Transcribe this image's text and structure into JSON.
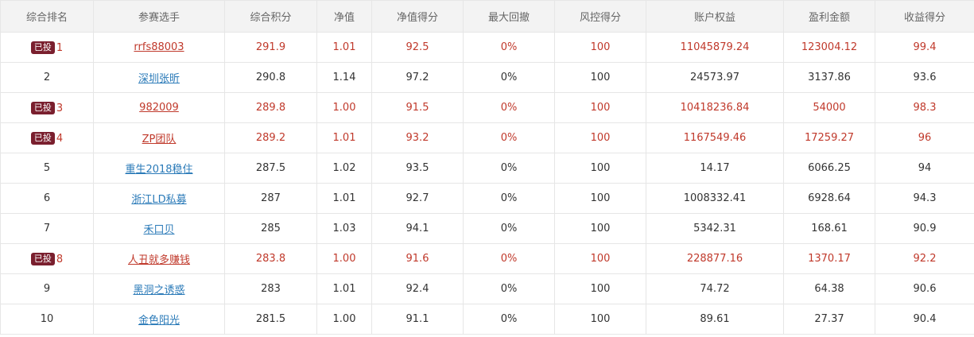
{
  "table": {
    "headers": [
      "综合排名",
      "参赛选手",
      "综合积分",
      "净值",
      "净值得分",
      "最大回撤",
      "风控得分",
      "账户权益",
      "盈利金额",
      "收益得分"
    ],
    "rows": [
      {
        "badge": "已投",
        "rank": "1",
        "player": "rrfs88003",
        "score": "291.9",
        "nav": "1.01",
        "nav_score": "92.5",
        "max_drawdown": "0%",
        "risk_score": "100",
        "equity": "11045879.24",
        "profit": "123004.12",
        "return_score": "99.4",
        "highlight": true
      },
      {
        "badge": "",
        "rank": "2",
        "player": "深圳张昕",
        "score": "290.8",
        "nav": "1.14",
        "nav_score": "97.2",
        "max_drawdown": "0%",
        "risk_score": "100",
        "equity": "24573.97",
        "profit": "3137.86",
        "return_score": "93.6",
        "highlight": false
      },
      {
        "badge": "已投",
        "rank": "3",
        "player": "982009",
        "score": "289.8",
        "nav": "1.00",
        "nav_score": "91.5",
        "max_drawdown": "0%",
        "risk_score": "100",
        "equity": "10418236.84",
        "profit": "54000",
        "return_score": "98.3",
        "highlight": true
      },
      {
        "badge": "已投",
        "rank": "4",
        "player": "ZP团队",
        "score": "289.2",
        "nav": "1.01",
        "nav_score": "93.2",
        "max_drawdown": "0%",
        "risk_score": "100",
        "equity": "1167549.46",
        "profit": "17259.27",
        "return_score": "96",
        "highlight": true
      },
      {
        "badge": "",
        "rank": "5",
        "player": "重生2018稳住",
        "score": "287.5",
        "nav": "1.02",
        "nav_score": "93.5",
        "max_drawdown": "0%",
        "risk_score": "100",
        "equity": "14.17",
        "profit": "6066.25",
        "return_score": "94",
        "highlight": false
      },
      {
        "badge": "",
        "rank": "6",
        "player": "浙江LD私募",
        "score": "287",
        "nav": "1.01",
        "nav_score": "92.7",
        "max_drawdown": "0%",
        "risk_score": "100",
        "equity": "1008332.41",
        "profit": "6928.64",
        "return_score": "94.3",
        "highlight": false
      },
      {
        "badge": "",
        "rank": "7",
        "player": "禾口贝",
        "score": "285",
        "nav": "1.03",
        "nav_score": "94.1",
        "max_drawdown": "0%",
        "risk_score": "100",
        "equity": "5342.31",
        "profit": "168.61",
        "return_score": "90.9",
        "highlight": false
      },
      {
        "badge": "已投",
        "rank": "8",
        "player": "人丑就多赚钱",
        "score": "283.8",
        "nav": "1.00",
        "nav_score": "91.6",
        "max_drawdown": "0%",
        "risk_score": "100",
        "equity": "228877.16",
        "profit": "1370.17",
        "return_score": "92.2",
        "highlight": true
      },
      {
        "badge": "",
        "rank": "9",
        "player": "黑洞之诱惑",
        "score": "283",
        "nav": "1.01",
        "nav_score": "92.4",
        "max_drawdown": "0%",
        "risk_score": "100",
        "equity": "74.72",
        "profit": "64.38",
        "return_score": "90.6",
        "highlight": false
      },
      {
        "badge": "",
        "rank": "10",
        "player": "金色阳光",
        "score": "281.5",
        "nav": "1.00",
        "nav_score": "91.1",
        "max_drawdown": "0%",
        "risk_score": "100",
        "equity": "89.61",
        "profit": "27.37",
        "return_score": "90.4",
        "highlight": false
      }
    ]
  },
  "colors": {
    "highlight_text": "#c0392b",
    "link": "#2a7ab8",
    "badge_bg": "#7a1f2e",
    "header_bg": "#f3f3f3",
    "border": "#e6e6e6"
  }
}
